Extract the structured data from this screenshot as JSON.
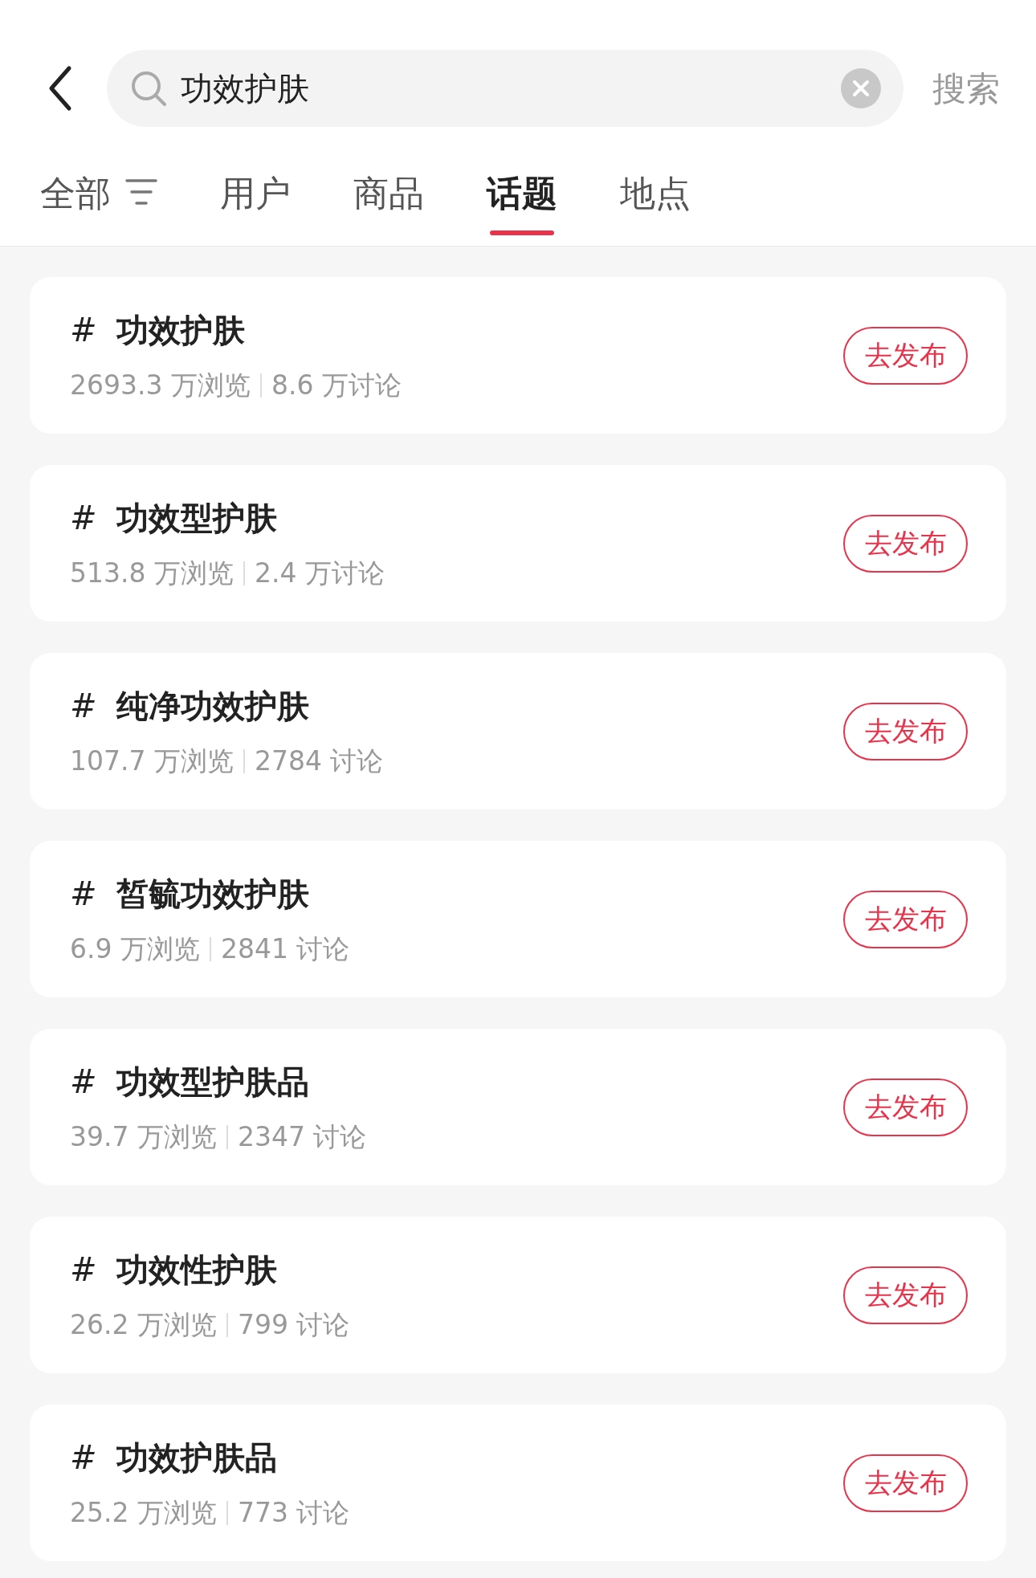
{
  "search_bar": {
    "query": "功效护肤",
    "search_button": "搜索"
  },
  "tabs": [
    {
      "label": "全部",
      "selected": false,
      "filter": true
    },
    {
      "label": "用户",
      "selected": false,
      "filter": false
    },
    {
      "label": "商品",
      "selected": false,
      "filter": false
    },
    {
      "label": "话题",
      "selected": true,
      "filter": false
    },
    {
      "label": "地点",
      "selected": false,
      "filter": false
    }
  ],
  "topics": [
    {
      "mark": "#",
      "title": "功效护肤",
      "views": "2693.3 万浏览",
      "discussions": "8.6 万讨论",
      "button": "去发布"
    },
    {
      "mark": "#",
      "title": "功效型护肤",
      "views": "513.8 万浏览",
      "discussions": "2.4 万讨论",
      "button": "去发布"
    },
    {
      "mark": "#",
      "title": "纯净功效护肤",
      "views": "107.7 万浏览",
      "discussions": "2784 讨论",
      "button": "去发布"
    },
    {
      "mark": "#",
      "title": "皙毓功效护肤",
      "views": "6.9 万浏览",
      "discussions": "2841 讨论",
      "button": "去发布"
    },
    {
      "mark": "#",
      "title": "功效型护肤品",
      "views": "39.7 万浏览",
      "discussions": "2347 讨论",
      "button": "去发布"
    },
    {
      "mark": "#",
      "title": "功效性护肤",
      "views": "26.2 万浏览",
      "discussions": "799 讨论",
      "button": "去发布"
    },
    {
      "mark": "#",
      "title": "功效护肤品",
      "views": "25.2 万浏览",
      "discussions": "773 讨论",
      "button": "去发布"
    }
  ]
}
